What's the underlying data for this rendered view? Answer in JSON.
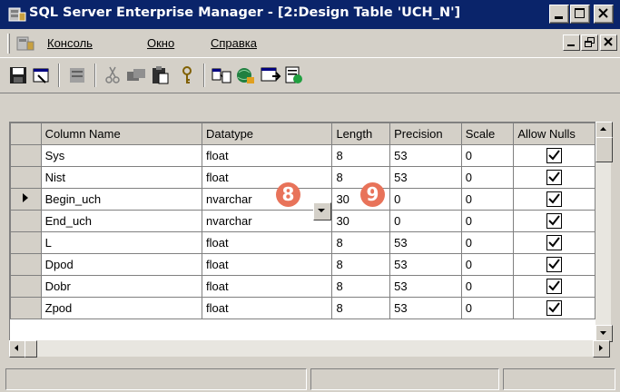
{
  "window": {
    "title": "SQL Server Enterprise Manager - [2:Design Table 'UCH_N']",
    "app_icon": "enterprise-manager-icon"
  },
  "menubar": {
    "items": [
      {
        "label": "Консоль"
      },
      {
        "label": "Окно"
      },
      {
        "label": "Справка"
      }
    ]
  },
  "toolbar": {
    "buttons": [
      "save-icon",
      "properties-icon",
      "manage-indexes-icon",
      "cut-icon",
      "copy-icon",
      "paste-icon",
      "set-primary-key-icon",
      "manage-relationships-icon",
      "manage-constraints-icon",
      "manage-triggers-icon",
      "generate-script-icon"
    ]
  },
  "grid": {
    "columns": [
      "Column Name",
      "Datatype",
      "Length",
      "Precision",
      "Scale",
      "Allow Nulls"
    ],
    "rows": [
      {
        "name": "Sys",
        "datatype": "float",
        "length": "8",
        "precision": "53",
        "scale": "0",
        "allow_nulls": true
      },
      {
        "name": "Nist",
        "datatype": "float",
        "length": "8",
        "precision": "53",
        "scale": "0",
        "allow_nulls": true
      },
      {
        "name": "Begin_uch",
        "datatype": "nvarchar",
        "length": "30",
        "precision": "0",
        "scale": "0",
        "allow_nulls": true,
        "current": true
      },
      {
        "name": "End_uch",
        "datatype": "nvarchar",
        "length": "30",
        "precision": "0",
        "scale": "0",
        "allow_nulls": true
      },
      {
        "name": "L",
        "datatype": "float",
        "length": "8",
        "precision": "53",
        "scale": "0",
        "allow_nulls": true
      },
      {
        "name": "Dpod",
        "datatype": "float",
        "length": "8",
        "precision": "53",
        "scale": "0",
        "allow_nulls": true
      },
      {
        "name": "Dobr",
        "datatype": "float",
        "length": "8",
        "precision": "53",
        "scale": "0",
        "allow_nulls": true
      },
      {
        "name": "Zpod",
        "datatype": "float",
        "length": "8",
        "precision": "53",
        "scale": "0",
        "allow_nulls": true
      }
    ]
  },
  "callouts": [
    "8",
    "9"
  ],
  "colors": {
    "titlebar": "#0a246a",
    "callout": "#e8735a",
    "face": "#d4d0c8"
  }
}
